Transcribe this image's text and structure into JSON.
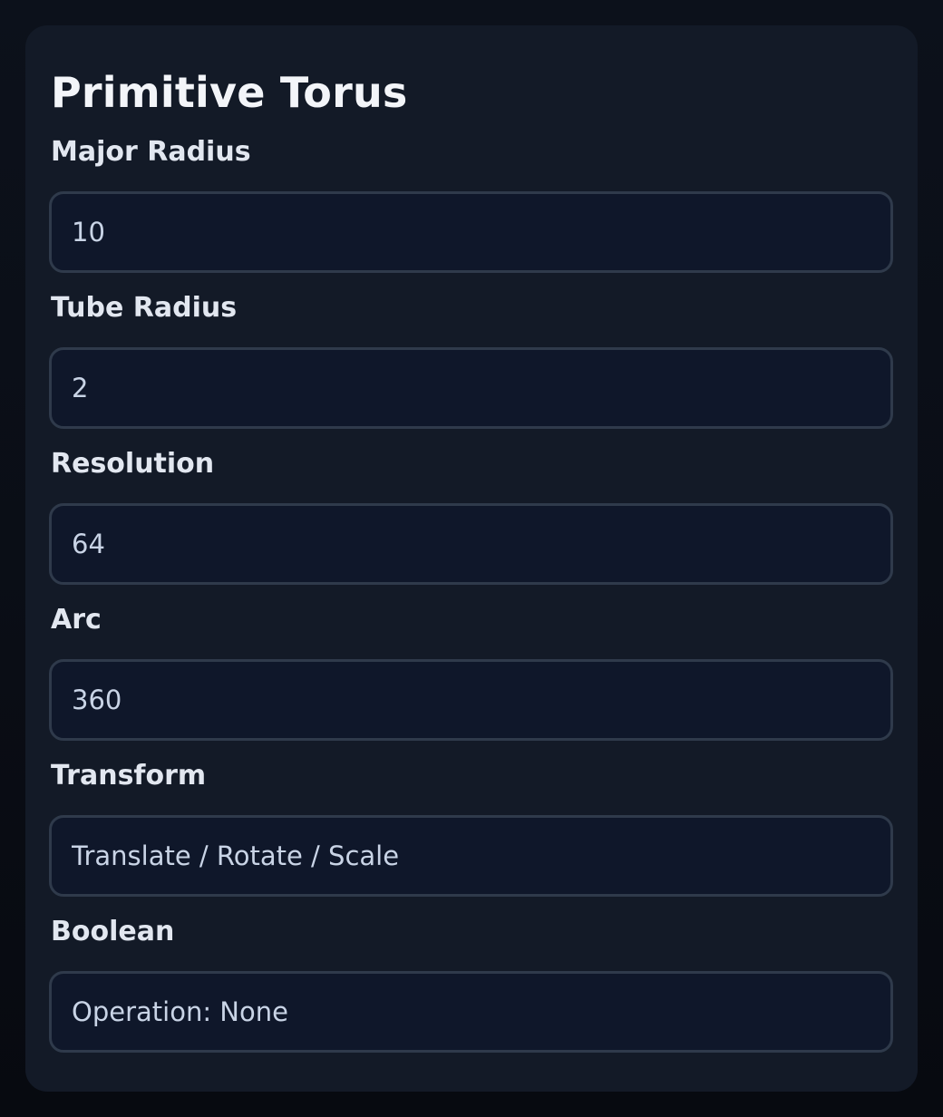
{
  "panel": {
    "title": "Primitive Torus",
    "fields": [
      {
        "label": "Major Radius",
        "value": "10"
      },
      {
        "label": "Tube Radius",
        "value": "2"
      },
      {
        "label": "Resolution",
        "value": "64"
      },
      {
        "label": "Arc",
        "value": "360"
      },
      {
        "label": "Transform",
        "value": "Translate / Rotate / Scale"
      },
      {
        "label": "Boolean",
        "value": "Operation: None"
      }
    ]
  },
  "colors": {
    "page_background": "#0b0f19",
    "panel_background": "#131a27",
    "input_background": "#0f172a",
    "input_border": "#2f3a4b",
    "title_text": "#f3f5f9",
    "label_text": "#e2e7f0",
    "value_text": "#c9d4e6"
  }
}
